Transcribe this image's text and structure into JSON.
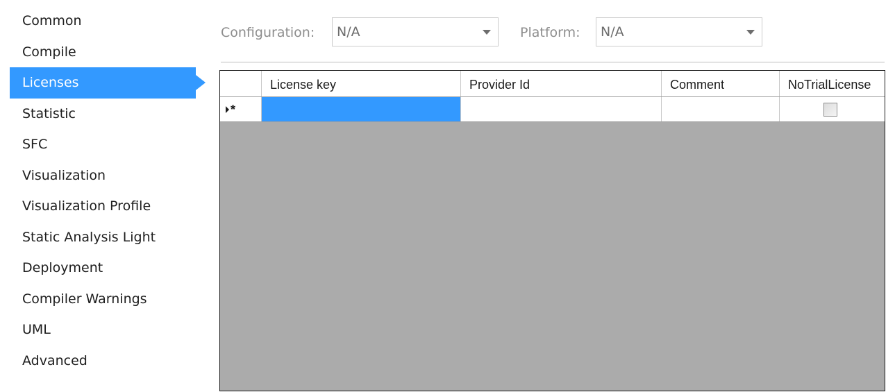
{
  "sidebar": {
    "items": [
      {
        "label": "Common",
        "icon": ""
      },
      {
        "label": "Compile",
        "icon": ""
      },
      {
        "label": "Licenses",
        "icon": "",
        "selected": true
      },
      {
        "label": "Statistic",
        "icon": ""
      },
      {
        "label": "SFC",
        "icon": ""
      },
      {
        "label": "Visualization",
        "icon": ""
      },
      {
        "label": "Visualization Profile",
        "icon": ""
      },
      {
        "label": "Static Analysis Light",
        "icon": ""
      },
      {
        "label": "Deployment",
        "icon": ""
      },
      {
        "label": "Compiler Warnings",
        "icon": ""
      },
      {
        "label": "UML",
        "icon": ""
      },
      {
        "label": "Advanced",
        "icon": ""
      }
    ],
    "selected_color": "#3399ff"
  },
  "config": {
    "configuration_label": "Configuration:",
    "configuration_value": "N/A",
    "platform_label": "Platform:",
    "platform_value": "N/A"
  },
  "grid": {
    "columns": [
      "License key",
      "Provider Id",
      "Comment",
      "NoTrialLicense"
    ],
    "new_row_marker": "*",
    "rows": [
      {
        "license_key": "",
        "provider_id": "",
        "comment": "",
        "no_trial_license": false
      }
    ],
    "empty_area_color": "#ababab",
    "selected_cell_color": "#3399ff"
  }
}
